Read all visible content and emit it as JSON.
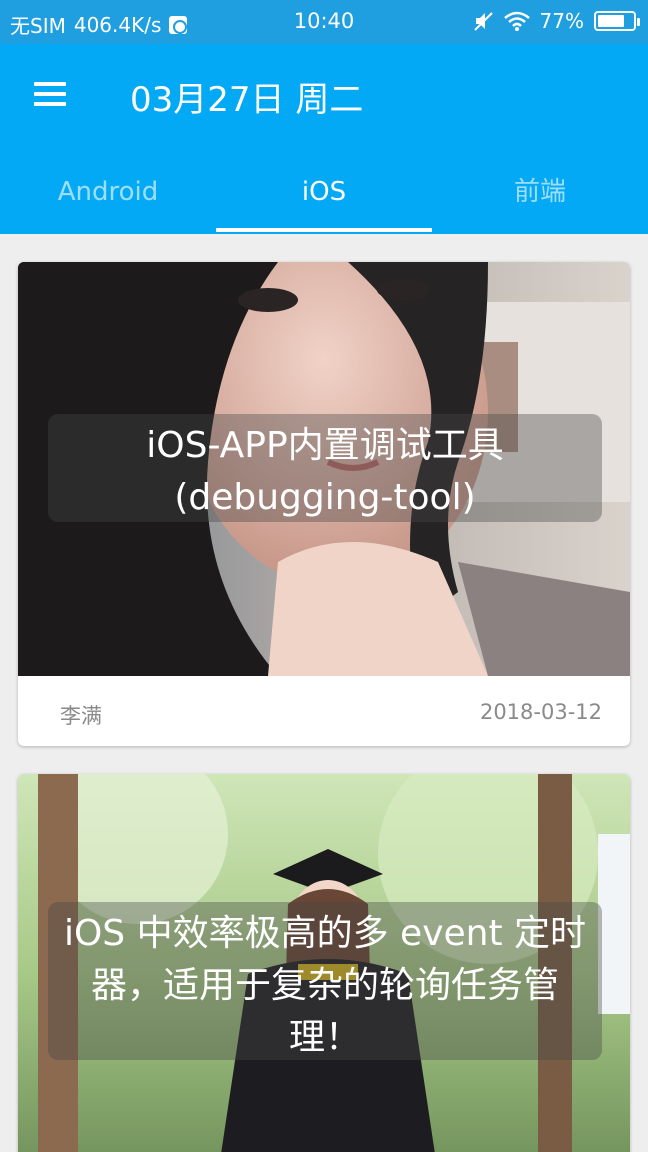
{
  "status_bar": {
    "carrier": "无SIM",
    "speed": "406.4K/s",
    "time": "10:40",
    "battery_percent": "77%",
    "battery_level": 0.77
  },
  "app_bar": {
    "title": "03月27日 周二"
  },
  "tabs": [
    {
      "label": "Android"
    },
    {
      "label": "iOS"
    },
    {
      "label": "前端"
    }
  ],
  "active_tab": 1,
  "cards": [
    {
      "title": "iOS-APP内置调试工具 (debugging-tool)",
      "author": "李满",
      "date": "2018-03-12"
    },
    {
      "title": "iOS 中效率极高的多 event 定时器，适用于复杂的轮询任务管理！"
    }
  ],
  "colors": {
    "status_bar": "#1f9ee0",
    "app_bar": "#03a9f4",
    "background": "#eeeeee"
  }
}
